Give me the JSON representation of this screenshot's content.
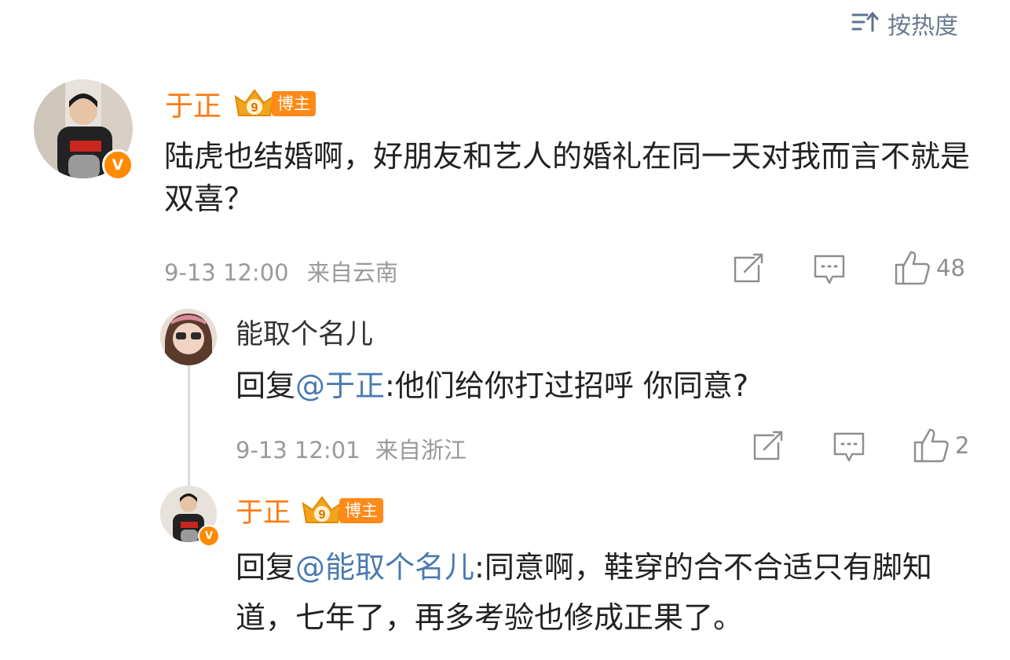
{
  "sort": {
    "label": "按热度"
  },
  "comment": {
    "author": "于正",
    "badge": "博主",
    "badge_level": "9",
    "verified": "V",
    "text": "陆虎也结婚啊，好朋友和艺人的婚礼在同一天对我而言不就是双喜？",
    "date": "9-13 12:00",
    "source": "来自云南",
    "likes": "48"
  },
  "replies": [
    {
      "author": "能取个名儿",
      "prefix": "回复",
      "mention": "@于正",
      "text": ":他们给你打过招呼 你同意?",
      "date": "9-13 12:01",
      "source": "来自浙江",
      "likes": "2"
    },
    {
      "author": "于正",
      "badge": "博主",
      "badge_level": "9",
      "verified": "V",
      "prefix": "回复",
      "mention": "@能取个名儿",
      "text": ":同意啊，鞋穿的合不合适只有脚知道，七年了，再多考验也修成正果了。"
    }
  ],
  "colors": {
    "name": "#ff7a12",
    "mention": "#4a7ab0",
    "badge": "#ff8a18",
    "meta": "#9a9a9a"
  }
}
